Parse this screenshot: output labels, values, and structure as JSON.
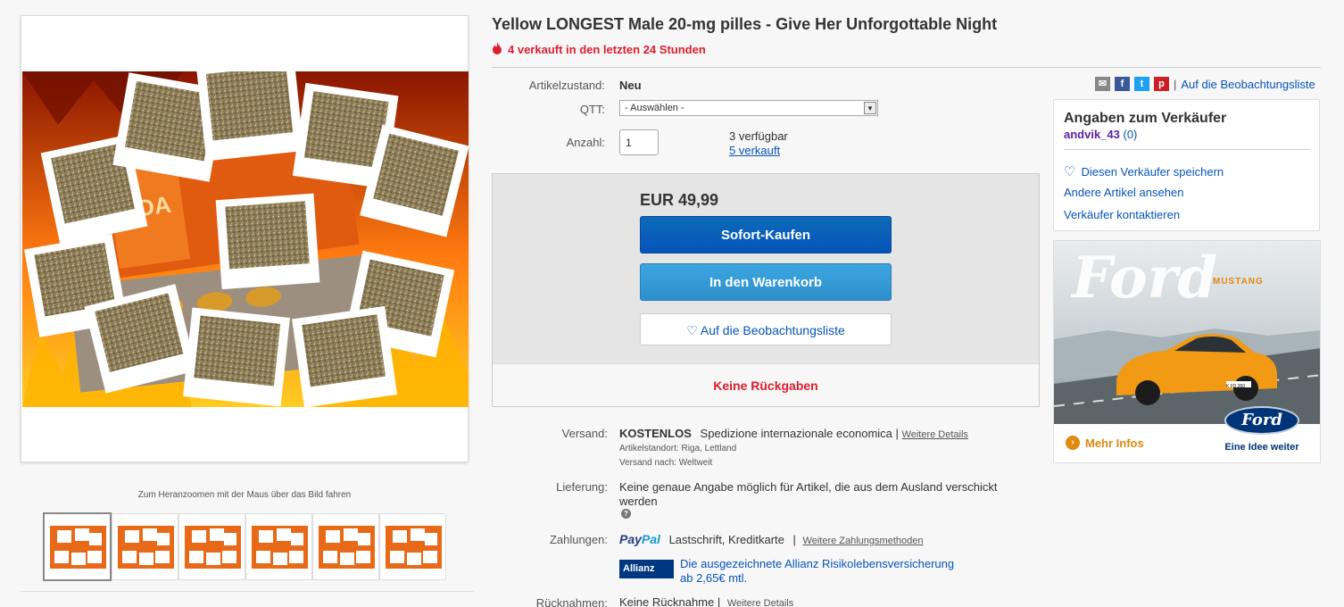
{
  "product": {
    "title": "Yellow LONGEST Male 20-mg pilles - Give Her Unforgottable Night",
    "sold_recent": "4 verkauft in den letzten 24 Stunden"
  },
  "gallery": {
    "zoom_hint": "Zum Heranzoomen mit der Maus über das Bild fahren",
    "thumb_count": 6
  },
  "details": {
    "condition_label": "Artikelzustand:",
    "condition_value": "Neu",
    "qtt_label": "QTT:",
    "qtt_selected": "- Auswählen -",
    "quantity_label": "Anzahl:",
    "quantity_value": "1",
    "available": "3 verfügbar",
    "sold": "5 verkauft"
  },
  "buy_box": {
    "price": "EUR 49,99",
    "buy_now": "Sofort-Kaufen",
    "add_to_cart": "In den Warenkorb",
    "watch": "Auf die Beobachtungsliste",
    "no_returns": "Keine Rückgaben"
  },
  "shipping": {
    "label": "Versand:",
    "free": "KOSTENLOS",
    "method": "Spedizione internazionale economica",
    "separator": "|",
    "more": "Weitere Details",
    "location": "Artikelstandort:  Riga, Lettland",
    "ships_to": "Versand nach:  Weltweit"
  },
  "delivery": {
    "label": "Lieferung:",
    "text": "Keine genaue Angabe möglich für Artikel, die aus dem Ausland verschickt werden",
    "help": "?"
  },
  "payment": {
    "label": "Zahlungen:",
    "paypal_a": "Pay",
    "paypal_b": "Pal",
    "methods": "Lastschrift,  Kreditkarte",
    "separator": "|",
    "more": "Weitere Zahlungsmethoden",
    "allianz_logo": "Allianz",
    "allianz_line1": "Die ausgezeichnete Allianz Risikolebensversicherung",
    "allianz_line2": "ab 2,65€ mtl."
  },
  "returns": {
    "label": "Rücknahmen:",
    "text": "Keine Rücknahme",
    "separator": "|",
    "more": "Weitere Details"
  },
  "share": {
    "separator": "|",
    "watch_link": "Auf die Beobachtungsliste",
    "facebook": "f",
    "twitter": "t",
    "pinterest": "p"
  },
  "seller": {
    "title": "Angaben zum Verkäufer",
    "name": "andvik_43",
    "score": "(0)",
    "save": "Diesen Verkäufer speichern",
    "other_items": "Andere Artikel ansehen",
    "contact": "Verkäufer kontaktieren"
  },
  "ad": {
    "logo_script": "Ford",
    "model": "MUSTANG",
    "plate": "K FD 350",
    "more": "Mehr Infos",
    "badge": "Ford",
    "tagline": "Eine Idee weiter"
  },
  "colors": {
    "accent_red": "#dd1e31",
    "link_blue": "#0654ba",
    "buy_blue": "#0654ba",
    "cart_blue": "#3ca6e0"
  }
}
